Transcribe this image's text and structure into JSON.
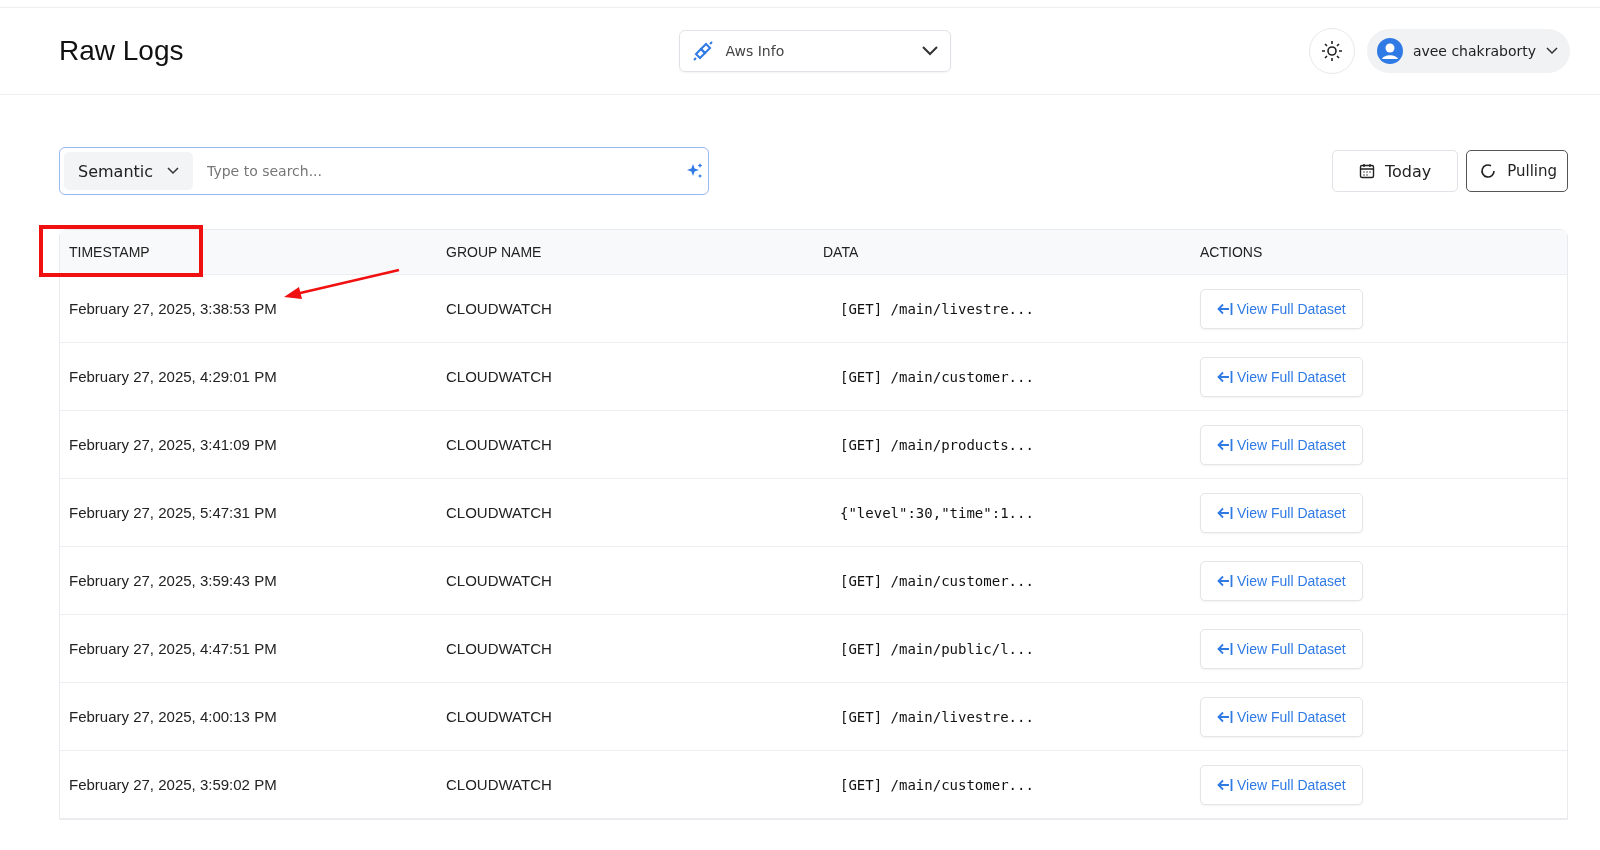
{
  "header": {
    "title": "Raw Logs",
    "source_select": {
      "value": "Aws Info"
    },
    "user": {
      "name": "avee chakraborty"
    }
  },
  "search": {
    "mode": "Semantic",
    "placeholder": "Type to search..."
  },
  "date_button": "Today",
  "pulling_button": "Pulling",
  "table": {
    "columns": [
      "TIMESTAMP",
      "GROUP NAME",
      "DATA",
      "ACTIONS"
    ],
    "rows": [
      {
        "timestamp": "February 27, 2025, 3:38:53 PM",
        "group": "CLOUDWATCH",
        "data": "[GET] /main/livestre...",
        "action": "View Full Dataset"
      },
      {
        "timestamp": "February 27, 2025, 4:29:01 PM",
        "group": "CLOUDWATCH",
        "data": "[GET] /main/customer...",
        "action": "View Full Dataset"
      },
      {
        "timestamp": "February 27, 2025, 3:41:09 PM",
        "group": "CLOUDWATCH",
        "data": "[GET] /main/products...",
        "action": "View Full Dataset"
      },
      {
        "timestamp": "February 27, 2025, 5:47:31 PM",
        "group": "CLOUDWATCH",
        "data": "{\"level\":30,\"time\":1...",
        "action": "View Full Dataset"
      },
      {
        "timestamp": "February 27, 2025, 3:59:43 PM",
        "group": "CLOUDWATCH",
        "data": "[GET] /main/customer...",
        "action": "View Full Dataset"
      },
      {
        "timestamp": "February 27, 2025, 4:47:51 PM",
        "group": "CLOUDWATCH",
        "data": "[GET] /main/public/l...",
        "action": "View Full Dataset"
      },
      {
        "timestamp": "February 27, 2025, 4:00:13 PM",
        "group": "CLOUDWATCH",
        "data": "[GET] /main/livestre...",
        "action": "View Full Dataset"
      },
      {
        "timestamp": "February 27, 2025, 3:59:02 PM",
        "group": "CLOUDWATCH",
        "data": "[GET] /main/customer...",
        "action": "View Full Dataset"
      }
    ]
  }
}
